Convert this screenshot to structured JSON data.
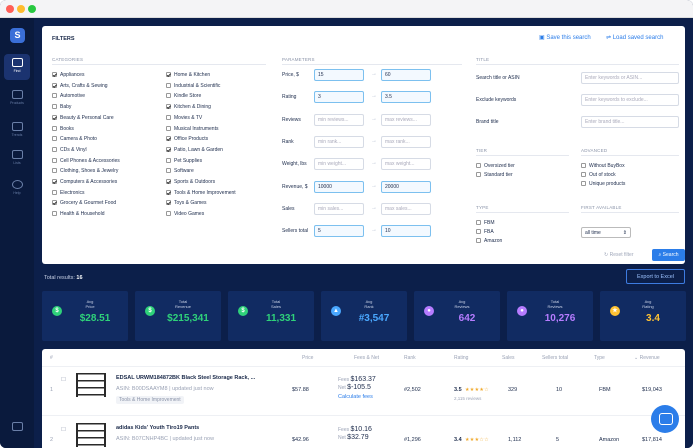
{
  "app": {
    "logo": "S"
  },
  "nav": [
    {
      "label": "Find",
      "icon": "search-icon",
      "active": true
    },
    {
      "label": "Products",
      "icon": "box-icon",
      "active": false
    },
    {
      "label": "Trends",
      "icon": "chart-icon",
      "active": false
    },
    {
      "label": "Lists",
      "icon": "list-icon",
      "active": false
    },
    {
      "label": "Help",
      "icon": "help-icon",
      "active": false
    },
    {
      "label": "",
      "icon": "logout-icon",
      "active": false
    }
  ],
  "filters": {
    "title": "FILTERS",
    "save_search": "Save this search",
    "load_search": "Load saved search",
    "categories_label": "CATEGORIES",
    "parameters_label": "PARAMETERS",
    "title_label": "TITLE",
    "tier_label": "TIER",
    "advanced_label": "ADVANCED",
    "type_label": "TYPE",
    "first_available_label": "FIRST AVAILABLE",
    "categories_col1": [
      {
        "label": "Appliances",
        "checked": true
      },
      {
        "label": "Arts, Crafts & Sewing",
        "checked": true
      },
      {
        "label": "Automotive",
        "checked": false
      },
      {
        "label": "Baby",
        "checked": false
      },
      {
        "label": "Beauty & Personal Care",
        "checked": true
      },
      {
        "label": "Books",
        "checked": false
      },
      {
        "label": "Camera & Photo",
        "checked": false
      },
      {
        "label": "CDs & Vinyl",
        "checked": false
      },
      {
        "label": "Cell Phones & Accessories",
        "checked": false
      },
      {
        "label": "Clothing, Shoes & Jewelry",
        "checked": false
      },
      {
        "label": "Computers & Accessories",
        "checked": true
      },
      {
        "label": "Electronics",
        "checked": false
      },
      {
        "label": "Grocery & Gourmet Food",
        "checked": true
      },
      {
        "label": "Health & Household",
        "checked": false
      }
    ],
    "categories_col2": [
      {
        "label": "Home & Kitchen",
        "checked": true
      },
      {
        "label": "Industrial & Scientific",
        "checked": false
      },
      {
        "label": "Kindle Store",
        "checked": false
      },
      {
        "label": "Kitchen & Dining",
        "checked": true
      },
      {
        "label": "Movies & TV",
        "checked": false
      },
      {
        "label": "Musical Instruments",
        "checked": false
      },
      {
        "label": "Office Products",
        "checked": true
      },
      {
        "label": "Patio, Lawn & Garden",
        "checked": true
      },
      {
        "label": "Pet Supplies",
        "checked": false
      },
      {
        "label": "Software",
        "checked": false
      },
      {
        "label": "Sports & Outdoors",
        "checked": true
      },
      {
        "label": "Tools & Home Improvement",
        "checked": true
      },
      {
        "label": "Toys & Games",
        "checked": true
      },
      {
        "label": "Video Games",
        "checked": false
      }
    ],
    "parameters": [
      {
        "label": "Price, $",
        "min": "15",
        "max": "60",
        "min_set": true,
        "max_set": true
      },
      {
        "label": "Rating",
        "min": "3",
        "max": "3.5",
        "min_set": true,
        "max_set": true
      },
      {
        "label": "Reviews",
        "min": "min reviews...",
        "max": "max reviews...",
        "min_set": false,
        "max_set": false
      },
      {
        "label": "Rank",
        "min": "min rank...",
        "max": "max rank...",
        "min_set": false,
        "max_set": false
      },
      {
        "label": "Weight, lbs",
        "min": "min weight...",
        "max": "max weight...",
        "min_set": false,
        "max_set": false
      },
      {
        "label": "Revenue, $",
        "min": "10000",
        "max": "20000",
        "min_set": true,
        "max_set": true
      },
      {
        "label": "Sales",
        "min": "min sales...",
        "max": "max sales...",
        "min_set": false,
        "max_set": false
      },
      {
        "label": "Sellers total",
        "min": "5",
        "max": "10",
        "min_set": true,
        "max_set": true
      }
    ],
    "title_fields": [
      {
        "label": "Search title or ASIN",
        "placeholder": "Enter keywords or ASIN..."
      },
      {
        "label": "Exclude keywords",
        "placeholder": "Enter keywords to exclude..."
      },
      {
        "label": "Brand title",
        "placeholder": "Enter brand title..."
      }
    ],
    "tier": [
      {
        "label": "Oversized tier",
        "checked": false
      },
      {
        "label": "Standard tier",
        "checked": false
      }
    ],
    "advanced": [
      {
        "label": "Without BuyBox",
        "checked": false
      },
      {
        "label": "Out of stock",
        "checked": false
      },
      {
        "label": "Unique products",
        "checked": false
      }
    ],
    "type": [
      {
        "label": "FBM",
        "checked": false
      },
      {
        "label": "FBA",
        "checked": false
      },
      {
        "label": "Amazon",
        "checked": false
      }
    ],
    "first_available_value": "all time",
    "reset": "Reset filter",
    "search": "Search"
  },
  "results": {
    "total_label": "Total results:",
    "total_value": "16",
    "export": "Export to Excel"
  },
  "stats": [
    {
      "label1": "Avg",
      "label2": "Price",
      "value": "$28.51",
      "color": "#2fd27a",
      "icon": "$"
    },
    {
      "label1": "Total",
      "label2": "Revenue",
      "value": "$215,341",
      "color": "#2fd27a",
      "icon": "$"
    },
    {
      "label1": "Total",
      "label2": "Sales",
      "value": "11,331",
      "color": "#2fd27a",
      "icon": "$"
    },
    {
      "label1": "Avg",
      "label2": "Rank",
      "value": "#3,547",
      "color": "#4aa8ff",
      "icon": "▲"
    },
    {
      "label1": "Avg",
      "label2": "Reviews",
      "value": "642",
      "color": "#b67cff",
      "icon": "●"
    },
    {
      "label1": "Total",
      "label2": "Reviews",
      "value": "10,276",
      "color": "#b67cff",
      "icon": "●"
    },
    {
      "label1": "Avg",
      "label2": "Rating",
      "value": "3.4",
      "color": "#ffc233",
      "icon": "★"
    }
  ],
  "table": {
    "headers": [
      "#",
      "Price",
      "Fees & Net",
      "Rank",
      "Rating",
      "Sales",
      "Sellers total",
      "Type",
      "Revenue"
    ],
    "rows": [
      {
        "num": "1",
        "title": "EDSAL URWM184872BK Black Steel Storage Rack, ...",
        "asin_label": "ASIN:",
        "asin": "B00DSAAYM8",
        "updated": "updated just now",
        "category": "Tools & Home Improvement",
        "price": "$57.88",
        "fees_label": "Fees",
        "fees": "$163.37",
        "net_label": "Net",
        "net": "$-105.5",
        "calc": "Calculate fees",
        "rank": "#2,502",
        "rating": "3.5",
        "stars": "★★★★☆",
        "reviews": "329",
        "reviews_text": "2,115 reviews",
        "sales": "10",
        "type": "FBM",
        "revenue": "$19,043"
      },
      {
        "num": "2",
        "title": "adidas Kids' Youth Tiro19 Pants",
        "asin_label": "ASIN:",
        "asin": "B07CNHP4BC",
        "updated": "updated just now",
        "category": "",
        "price": "$42.96",
        "fees_label": "Fees",
        "fees": "$10.16",
        "net_label": "Net",
        "net": "$32.79",
        "calc": "",
        "rank": "#1,296",
        "rating": "3.4",
        "stars": "★★★☆☆",
        "reviews": "1,112",
        "reviews_text": "",
        "sales": "5",
        "type": "Amazon",
        "revenue": "$17,814"
      }
    ]
  }
}
